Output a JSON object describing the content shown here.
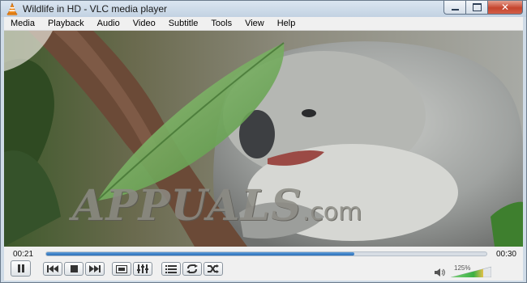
{
  "window": {
    "title": "Wildlife in HD - VLC media player"
  },
  "menu": [
    {
      "label": "Media"
    },
    {
      "label": "Playback"
    },
    {
      "label": "Audio"
    },
    {
      "label": "Video"
    },
    {
      "label": "Subtitle"
    },
    {
      "label": "Tools"
    },
    {
      "label": "View"
    },
    {
      "label": "Help"
    }
  ],
  "video": {
    "watermark": "APPUALS",
    "watermark_suffix": ".com"
  },
  "player": {
    "elapsed": "00:21",
    "total": "00:30",
    "progress": 0.7,
    "volume_label": "125%",
    "volume_level": 1.25
  },
  "colors": {
    "accent": "#2a6fb8",
    "titlebar": "#c2d2e2",
    "close": "#c5452e",
    "volume_green": "#3cb043"
  },
  "icons": [
    "vlc-cone-icon",
    "minimize-icon",
    "maximize-icon",
    "close-icon",
    "pause-icon",
    "previous-icon",
    "stop-icon",
    "next-icon",
    "fullscreen-icon",
    "extended-settings-icon",
    "playlist-icon",
    "loop-icon",
    "shuffle-icon",
    "speaker-icon"
  ]
}
